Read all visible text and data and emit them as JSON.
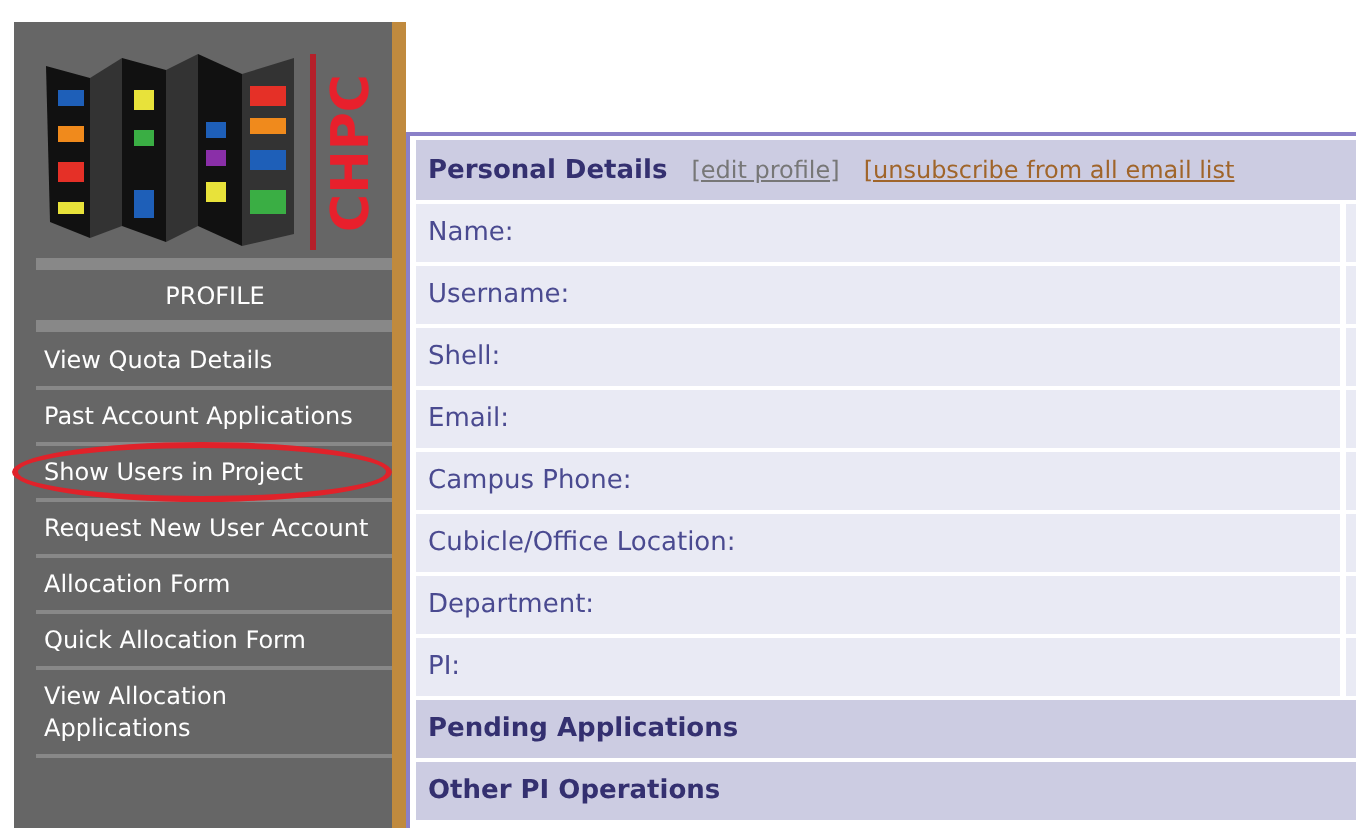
{
  "logo": {
    "text": "CHPC"
  },
  "sidebar": {
    "heading": "PROFILE",
    "items": [
      {
        "label": "View Quota Details",
        "circled": false
      },
      {
        "label": "Past Account Applications",
        "circled": false
      },
      {
        "label": "Show Users in Project",
        "circled": true
      },
      {
        "label": "Request New User Account",
        "circled": false
      },
      {
        "label": "Allocation Form",
        "circled": false
      },
      {
        "label": "Quick Allocation Form",
        "circled": false
      },
      {
        "label": "View Allocation Applications",
        "circled": false
      }
    ]
  },
  "personal_details": {
    "title": "Personal Details",
    "links": [
      "[edit profile]",
      "[unsubscribe from all email list"
    ],
    "fields": [
      "Name:",
      "Username:",
      "Shell:",
      "Email:",
      "Campus Phone:",
      "Cubicle/Office Location:",
      "Department:",
      "PI:"
    ]
  },
  "sections": [
    "Pending Applications",
    "Other PI Operations"
  ]
}
